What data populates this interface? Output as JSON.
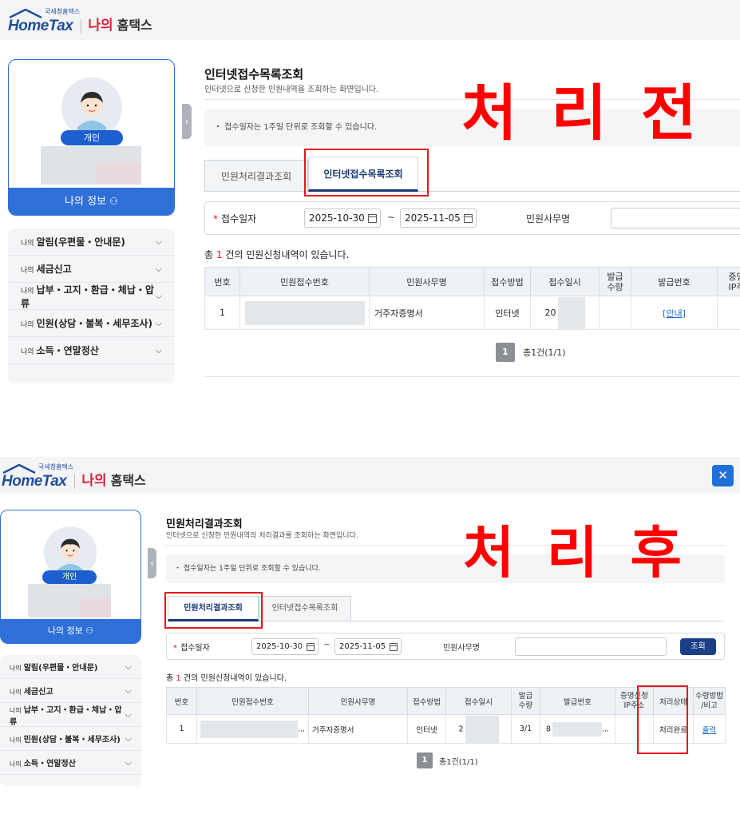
{
  "before": {
    "overlay_label": "처 리 전",
    "header": {
      "logo_sub": "국세청홈택스",
      "logo_word": "HomeTax",
      "my_na": "나의",
      "my_home": "홈택스"
    },
    "profile": {
      "badge": "개인",
      "myinfo": "나의 정보"
    },
    "menu": [
      {
        "prefix": "나의",
        "label": "알림(우편물・안내문)"
      },
      {
        "prefix": "나의",
        "label": "세금신고"
      },
      {
        "prefix": "나의",
        "label": "납부・고지・환급・체납・압류"
      },
      {
        "prefix": "나의",
        "label": "민원(상담・불복・세무조사)"
      },
      {
        "prefix": "나의",
        "label": "소득・연말정산"
      }
    ],
    "page_title": "인터넷접수목록조회",
    "page_subtitle": "인터넷으로 신청한 민원내역을 조회하는 화면입니다.",
    "notice": "・ 접수일자는 1주일 단위로 조회할 수 있습니다.",
    "tabs": [
      "민원처리결과조회",
      "인터넷접수목록조회"
    ],
    "search": {
      "date_label": "접수일자",
      "date_from": "2025-10-30",
      "date_to": "2025-11-05",
      "tilde": "~",
      "minwon_label": "민원사무명"
    },
    "count": {
      "pre": "총",
      "num": "1",
      "post": "건의 민원신청내역이 있습니다."
    },
    "table": {
      "headers": [
        "번호",
        "민원접수번호",
        "민원사무명",
        "접수방법",
        "접수일시",
        "발급\n수량",
        "발급번호",
        "증명\nIP주"
      ],
      "row": {
        "no": "1",
        "name": "거주자증명서",
        "method": "인터넷",
        "date_partial": "20",
        "issue_link": "[안내]"
      }
    },
    "pager": {
      "page": "1",
      "summary": "총1건(1/1)"
    }
  },
  "after": {
    "overlay_label": "처 리 후",
    "header": {
      "logo_sub": "국세청홈택스",
      "logo_word": "HomeTax",
      "my_na": "나의",
      "my_home": "홈택스",
      "close": "✕"
    },
    "profile": {
      "badge": "개인",
      "myinfo": "나의 정보"
    },
    "menu": [
      {
        "prefix": "나의",
        "label": "알림(우편물・안내문)"
      },
      {
        "prefix": "나의",
        "label": "세금신고"
      },
      {
        "prefix": "나의",
        "label": "납부・고지・환급・체납・압류"
      },
      {
        "prefix": "나의",
        "label": "민원(상담・불복・세무조사)"
      },
      {
        "prefix": "나의",
        "label": "소득・연말정산"
      }
    ],
    "page_title": "민원처리결과조회",
    "page_subtitle": "인터넷으로 신청한 민원내역의 처리결과를 조회하는 화면입니다.",
    "notice": "・ 접수일자는 1주일 단위로 조회할 수 있습니다.",
    "tabs": [
      "민원처리결과조회",
      "인터넷접수목록조회"
    ],
    "search": {
      "date_label": "접수일자",
      "date_from": "2025-10-30",
      "date_to": "2025-11-05",
      "tilde": "~",
      "minwon_label": "민원사무명",
      "button": "조회"
    },
    "count": {
      "pre": "총",
      "num": "1",
      "post": "건의 민원신청내역이 있습니다."
    },
    "table": {
      "headers": [
        "번호",
        "민원접수번호",
        "민원사무명",
        "접수방법",
        "접수일시",
        "발급\n수량",
        "발급번호",
        "증명신청\nIP주소",
        "처리상태",
        "수령방법\n/비고"
      ],
      "row": {
        "no": "1",
        "ellipsis": "...",
        "name": "거주자증명서",
        "method": "인터넷",
        "date_partial": "2",
        "qty": "3/1",
        "issue_partial": "8",
        "issue_ellipsis": "...",
        "status": "처리완료",
        "print": "출력"
      }
    },
    "pager": {
      "page": "1",
      "summary": "총1건(1/1)"
    }
  }
}
